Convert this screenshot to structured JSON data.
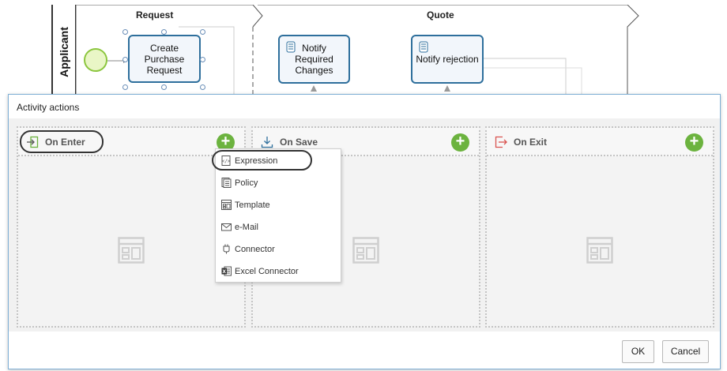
{
  "diagram": {
    "lane_label": "Applicant",
    "phases": [
      {
        "title": "Request"
      },
      {
        "title": "Quote"
      }
    ],
    "tasks": [
      {
        "label": "Create Purchase Request"
      },
      {
        "label": "Notify Required Changes"
      },
      {
        "label": "Notify rejection"
      }
    ]
  },
  "dialog": {
    "title": "Activity actions",
    "panels": [
      {
        "label": "On Enter",
        "icon": "enter-icon"
      },
      {
        "label": "On Save",
        "icon": "save-icon"
      },
      {
        "label": "On Exit",
        "icon": "exit-icon"
      }
    ],
    "menu": {
      "items": [
        {
          "label": "Expression",
          "icon": "expression-icon"
        },
        {
          "label": "Policy",
          "icon": "policy-icon"
        },
        {
          "label": "Template",
          "icon": "template-icon"
        },
        {
          "label": "e-Mail",
          "icon": "email-icon"
        },
        {
          "label": "Connector",
          "icon": "connector-icon"
        },
        {
          "label": "Excel Connector",
          "icon": "excel-icon"
        }
      ]
    },
    "buttons": {
      "ok": "OK",
      "cancel": "Cancel"
    }
  },
  "colors": {
    "task_border": "#2e6f9c",
    "start_event_border": "#8cc63f",
    "add_button": "#6cb33f",
    "dialog_border": "#7fb0d6",
    "exit_icon": "#d9534f",
    "save_icon": "#2e6f9c"
  }
}
